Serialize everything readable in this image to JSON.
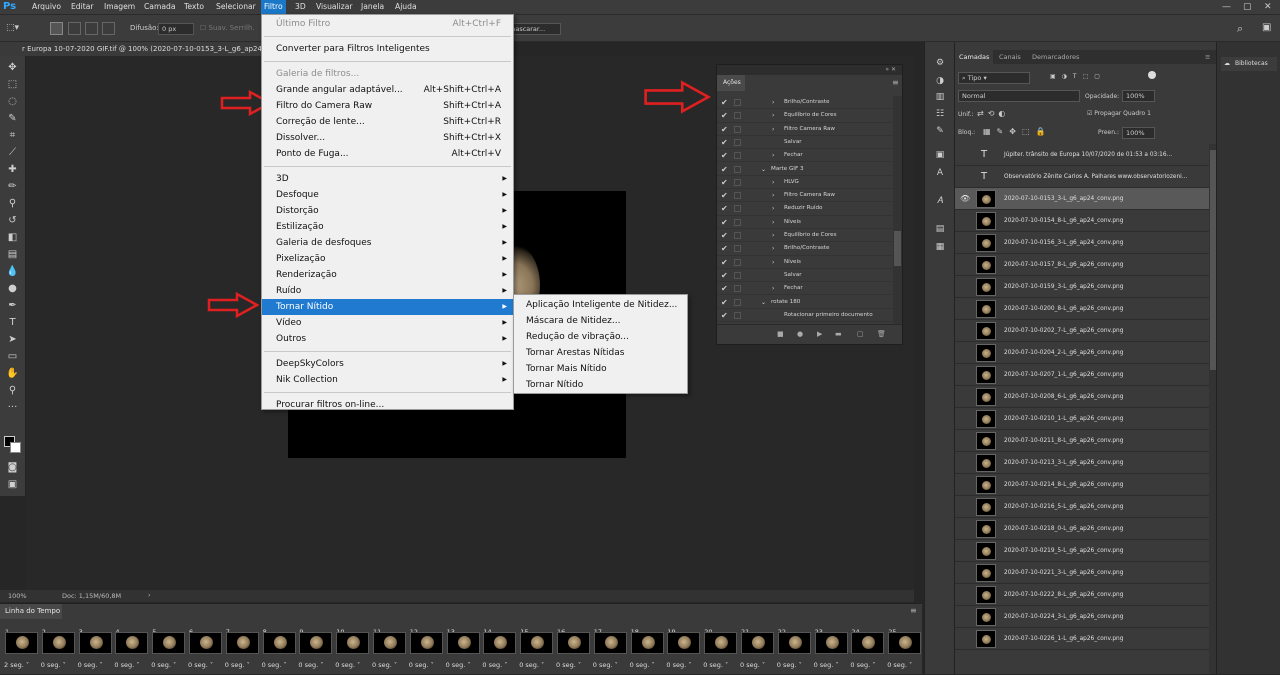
{
  "menubar": {
    "app_logo": "Ps",
    "items": [
      "Arquivo",
      "Editar",
      "Imagem",
      "Camada",
      "Texto",
      "Selecionar",
      "Filtro",
      "3D",
      "Visualizar",
      "Janela",
      "Ajuda"
    ],
    "active_item": "Filtro"
  },
  "options_bar": {
    "feather_label": "Difusão:",
    "feather_value": "0 px",
    "antialias_label": "Suav. Serrilh.",
    "mask_button": "mascarar..."
  },
  "document": {
    "tab_title": "r Europa 10-07-2020 GIF.tif @ 100% (2020-07-10-0153_3-L_g6_ap24_c",
    "zoom": "100%",
    "doc_info": "Doc: 1,15M/60,8M"
  },
  "filter_menu": {
    "items": [
      {
        "label": "Último Filtro",
        "shortcut": "Alt+Ctrl+F",
        "disabled": true
      },
      {
        "label": "Converter para Filtros Inteligentes",
        "shortcut": ""
      },
      {
        "label": "Galeria de filtros...",
        "shortcut": "",
        "disabled": true
      },
      {
        "label": "Grande angular adaptável...",
        "shortcut": "Alt+Shift+Ctrl+A"
      },
      {
        "label": "Filtro do Camera Raw",
        "shortcut": "Shift+Ctrl+A"
      },
      {
        "label": "Correção de lente...",
        "shortcut": "Shift+Ctrl+R"
      },
      {
        "label": "Dissolver...",
        "shortcut": "Shift+Ctrl+X"
      },
      {
        "label": "Ponto de Fuga...",
        "shortcut": "Alt+Ctrl+V"
      },
      {
        "label": "3D",
        "submenu": true
      },
      {
        "label": "Desfoque",
        "submenu": true
      },
      {
        "label": "Distorção",
        "submenu": true
      },
      {
        "label": "Estilização",
        "submenu": true
      },
      {
        "label": "Galeria de desfoques",
        "submenu": true
      },
      {
        "label": "Pixelização",
        "submenu": true
      },
      {
        "label": "Renderização",
        "submenu": true
      },
      {
        "label": "Ruído",
        "submenu": true
      },
      {
        "label": "Tornar Nítido",
        "submenu": true,
        "highlighted": true
      },
      {
        "label": "Vídeo",
        "submenu": true
      },
      {
        "label": "Outros",
        "submenu": true
      },
      {
        "label": "DeepSkyColors",
        "submenu": true
      },
      {
        "label": "Nik Collection",
        "submenu": true
      },
      {
        "label": "Procurar filtros on-line..."
      }
    ]
  },
  "sharpen_submenu": [
    "Aplicação Inteligente de Nitidez...",
    "Máscara de Nitidez...",
    "Redução de vibração...",
    "Tornar Arestas Nítidas",
    "Tornar Mais Nítido",
    "Tornar Nítido"
  ],
  "actions_panel": {
    "tab": "Ações",
    "rows": [
      {
        "label": "Brilho/Contraste",
        "indent": 2,
        "twisty": ">"
      },
      {
        "label": "Equilíbrio de Cores",
        "indent": 2,
        "twisty": ">"
      },
      {
        "label": "Filtro Camera Raw",
        "indent": 2,
        "twisty": ">"
      },
      {
        "label": "Salvar",
        "indent": 2,
        "twisty": ""
      },
      {
        "label": "Fechar",
        "indent": 2,
        "twisty": ">"
      },
      {
        "label": "Marte GIF 3",
        "indent": 1,
        "twisty": "v"
      },
      {
        "label": "HLVG",
        "indent": 2,
        "twisty": ">"
      },
      {
        "label": "Filtro Camera Raw",
        "indent": 2,
        "twisty": ">"
      },
      {
        "label": "Reduzir Ruído",
        "indent": 2,
        "twisty": ">"
      },
      {
        "label": "Níveis",
        "indent": 2,
        "twisty": ">"
      },
      {
        "label": "Equilíbrio de Cores",
        "indent": 2,
        "twisty": ">"
      },
      {
        "label": "Brilho/Contraste",
        "indent": 2,
        "twisty": ">"
      },
      {
        "label": "Níveis",
        "indent": 2,
        "twisty": ">"
      },
      {
        "label": "Salvar",
        "indent": 2,
        "twisty": ""
      },
      {
        "label": "Fechar",
        "indent": 2,
        "twisty": ">"
      },
      {
        "label": "rotate 180",
        "indent": 1,
        "twisty": "v"
      },
      {
        "label": "Rotacionar primeiro documento",
        "indent": 2,
        "twisty": ""
      }
    ]
  },
  "layers_panel": {
    "tabs": [
      "Camadas",
      "Canais",
      "Demarcadores"
    ],
    "kind_filter": "Tipo",
    "blend_mode": "Normal",
    "opacity_label": "Opacidade:",
    "opacity_value": "100%",
    "unify_label": "Unif.:",
    "propagate_label": "Propagar Quadro 1",
    "lock_label": "Bloq.:",
    "fill_label": "Preen.:",
    "fill_value": "100%",
    "layers": [
      {
        "name": "Júpiter. trânsito de Europa 10/07/2020 de 01:53 a 03:16...",
        "type": "text"
      },
      {
        "name": "Observatório Zênite Carlos A. Palhares www.observatoriozeni...",
        "type": "text"
      },
      {
        "name": "2020-07-10-0153_3-L_g6_ap24_conv.png",
        "type": "image",
        "selected": true,
        "visible": true
      },
      {
        "name": "2020-07-10-0154_8-L_g6_ap24_conv.png",
        "type": "image"
      },
      {
        "name": "2020-07-10-0156_3-L_g6_ap24_conv.png",
        "type": "image"
      },
      {
        "name": "2020-07-10-0157_8-L_g6_ap26_conv.png",
        "type": "image"
      },
      {
        "name": "2020-07-10-0159_3-L_g6_ap26_conv.png",
        "type": "image"
      },
      {
        "name": "2020-07-10-0200_8-L_g6_ap26_conv.png",
        "type": "image"
      },
      {
        "name": "2020-07-10-0202_7-L_g6_ap26_conv.png",
        "type": "image"
      },
      {
        "name": "2020-07-10-0204_2-L_g6_ap26_conv.png",
        "type": "image"
      },
      {
        "name": "2020-07-10-0207_1-L_g6_ap26_conv.png",
        "type": "image"
      },
      {
        "name": "2020-07-10-0208_6-L_g6_ap26_conv.png",
        "type": "image"
      },
      {
        "name": "2020-07-10-0210_1-L_g6_ap26_conv.png",
        "type": "image"
      },
      {
        "name": "2020-07-10-0211_8-L_g6_ap26_conv.png",
        "type": "image"
      },
      {
        "name": "2020-07-10-0213_3-L_g6_ap26_conv.png",
        "type": "image"
      },
      {
        "name": "2020-07-10-0214_8-L_g6_ap26_conv.png",
        "type": "image"
      },
      {
        "name": "2020-07-10-0216_5-L_g6_ap26_conv.png",
        "type": "image"
      },
      {
        "name": "2020-07-10-0218_0-L_g6_ap26_conv.png",
        "type": "image"
      },
      {
        "name": "2020-07-10-0219_5-L_g6_ap26_conv.png",
        "type": "image"
      },
      {
        "name": "2020-07-10-0221_3-L_g6_ap26_conv.png",
        "type": "image"
      },
      {
        "name": "2020-07-10-0222_8-L_g6_ap26_conv.png",
        "type": "image"
      },
      {
        "name": "2020-07-10-0224_3-L_g6_ap26_conv.png",
        "type": "image"
      },
      {
        "name": "2020-07-10-0226_1-L_g6_ap26_conv.png",
        "type": "image"
      }
    ]
  },
  "libraries": {
    "label": "Bibliotecas"
  },
  "timeline": {
    "tab": "Linha do Tempo",
    "frames": [
      {
        "n": "1",
        "delay": "2 seg."
      },
      {
        "n": "2",
        "delay": "0 seg."
      },
      {
        "n": "3",
        "delay": "0 seg."
      },
      {
        "n": "4",
        "delay": "0 seg."
      },
      {
        "n": "5",
        "delay": "0 seg."
      },
      {
        "n": "6",
        "delay": "0 seg."
      },
      {
        "n": "7",
        "delay": "0 seg."
      },
      {
        "n": "8",
        "delay": "0 seg."
      },
      {
        "n": "9",
        "delay": "0 seg."
      },
      {
        "n": "10",
        "delay": "0 seg."
      },
      {
        "n": "11",
        "delay": "0 seg."
      },
      {
        "n": "12",
        "delay": "0 seg."
      },
      {
        "n": "13",
        "delay": "0 seg."
      },
      {
        "n": "14",
        "delay": "0 seg."
      },
      {
        "n": "15",
        "delay": "0 seg."
      },
      {
        "n": "16",
        "delay": "0 seg."
      },
      {
        "n": "17",
        "delay": "0 seg."
      },
      {
        "n": "18",
        "delay": "0 seg."
      },
      {
        "n": "19",
        "delay": "0 seg."
      },
      {
        "n": "20",
        "delay": "0 seg."
      },
      {
        "n": "21",
        "delay": "0 seg."
      },
      {
        "n": "22",
        "delay": "0 seg."
      },
      {
        "n": "23",
        "delay": "0 seg."
      },
      {
        "n": "24",
        "delay": "0 seg."
      },
      {
        "n": "25",
        "delay": "0 seg."
      }
    ]
  },
  "colors": {
    "accent": "#1f7ad0",
    "arrow": "#e02020",
    "panel": "#3a3a3a",
    "menu": "#f0f0f0"
  }
}
